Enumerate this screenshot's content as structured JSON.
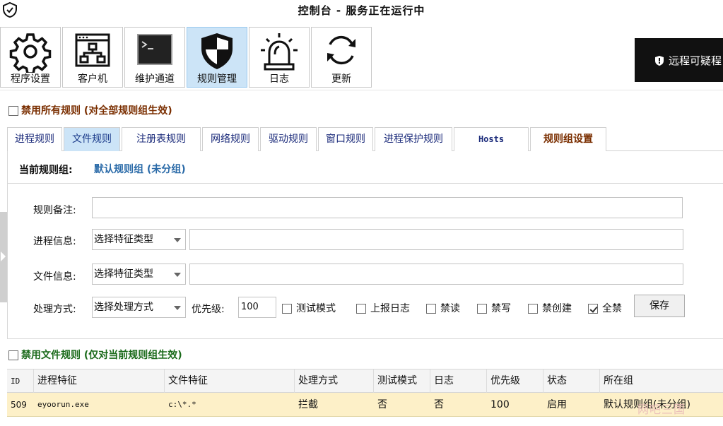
{
  "window": {
    "title": "控制台 - 服务正在运行中"
  },
  "toolbar": {
    "items": [
      {
        "label": "程序设置",
        "icon": "gear-icon"
      },
      {
        "label": "客户机",
        "icon": "network-window-icon"
      },
      {
        "label": "维护通道",
        "icon": "terminal-icon"
      },
      {
        "label": "规则管理",
        "icon": "shield-icon"
      },
      {
        "label": "日志",
        "icon": "alarm-light-icon"
      },
      {
        "label": "更新",
        "icon": "refresh-icon"
      }
    ],
    "active_index": 3
  },
  "remote_panel": {
    "text": "远程可疑程"
  },
  "disable_all": {
    "label": "禁用所有规则 (对全部规则组生效)",
    "checked": false
  },
  "tabs": [
    {
      "label": "进程规则"
    },
    {
      "label": "文件规则"
    },
    {
      "label": "注册表规则"
    },
    {
      "label": "网络规则"
    },
    {
      "label": "驱动规则"
    },
    {
      "label": "窗口规则"
    },
    {
      "label": "进程保护规则"
    },
    {
      "label": "Hosts"
    },
    {
      "label": "规则组设置"
    }
  ],
  "active_tab": 1,
  "current_group": {
    "label": "当前规则组:",
    "value": "默认规则组 (未分组)"
  },
  "form": {
    "remark_label": "规则备注:",
    "remark_value": "",
    "process_label": "进程信息:",
    "process_select": "选择特征类型",
    "process_value": "",
    "file_label": "文件信息:",
    "file_select": "选择特征类型",
    "file_value": "",
    "action_label": "处理方式:",
    "action_select": "选择处理方式",
    "priority_label": "优先级:",
    "priority_value": "100",
    "options": [
      {
        "label": "测试模式",
        "checked": false
      },
      {
        "label": "上报日志",
        "checked": false
      },
      {
        "label": "禁读",
        "checked": false
      },
      {
        "label": "禁写",
        "checked": false
      },
      {
        "label": "禁创建",
        "checked": false
      },
      {
        "label": "全禁",
        "checked": true
      }
    ],
    "save_label": "保存"
  },
  "disable_file": {
    "label": "禁用文件规则 (仅对当前规则组生效)",
    "checked": false
  },
  "table": {
    "columns": [
      "ID",
      "进程特征",
      "文件特征",
      "处理方式",
      "测试模式",
      "日志",
      "优先级",
      "状态",
      "所在组"
    ],
    "rows": [
      [
        "509",
        "eyoorun.exe",
        "c:\\*.*",
        "拦截",
        "否",
        "否",
        "100",
        "启用",
        "默认规则组(未分组)"
      ]
    ]
  },
  "watermark": "网吧三国",
  "colors": {
    "active_bg": "#cce4f7",
    "selected_row": "#fdf0c8",
    "warn_text": "#7a2e00",
    "green_text": "#1a6a1a"
  }
}
